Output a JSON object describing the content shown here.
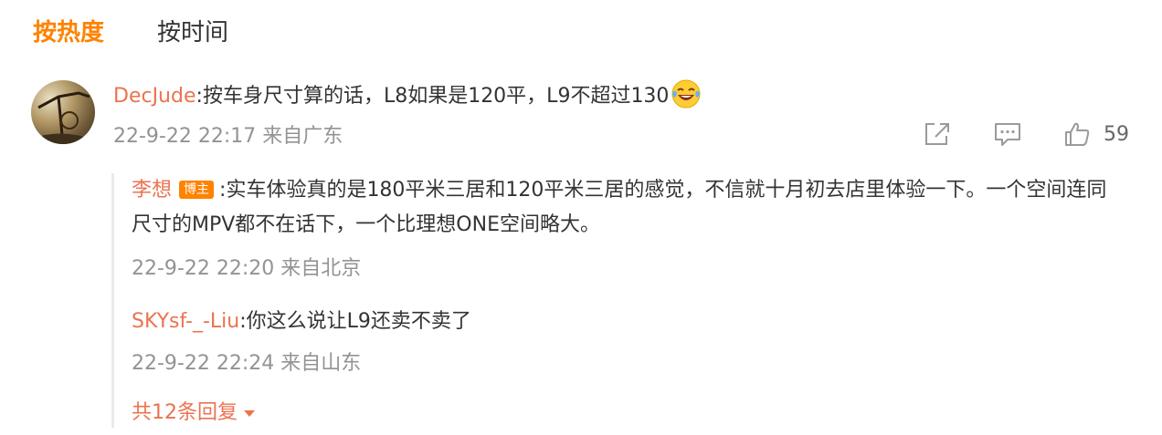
{
  "sort_tabs": {
    "hot": "按热度",
    "time": "按时间"
  },
  "comment": {
    "username": "DecJude",
    "separator": ":",
    "text": "按车身尺寸算的话，L8如果是120平，L9不超过130",
    "emoji": "laughing-tears-emoji",
    "time": "22-9-22 22:17",
    "location": "来自广东",
    "like_count": "59"
  },
  "replies": [
    {
      "username": "李想",
      "badge": "博主",
      "separator": ":",
      "text": "实车体验真的是180平米三居和120平米三居的感觉，不信就十月初去店里体验一下。一个空间连同尺寸的MPV都不在话下，一个比理想ONE空间略大。",
      "time": "22-9-22 22:20",
      "location": "来自北京"
    },
    {
      "username": "SKYsf-_-Liu",
      "separator": ":",
      "text": "你这么说让L9还卖不卖了",
      "time": "22-9-22 22:24",
      "location": "来自山东"
    }
  ],
  "more_replies": "共12条回复",
  "colors": {
    "accent": "#ff8200",
    "username": "#eb7350",
    "meta": "#939393"
  }
}
